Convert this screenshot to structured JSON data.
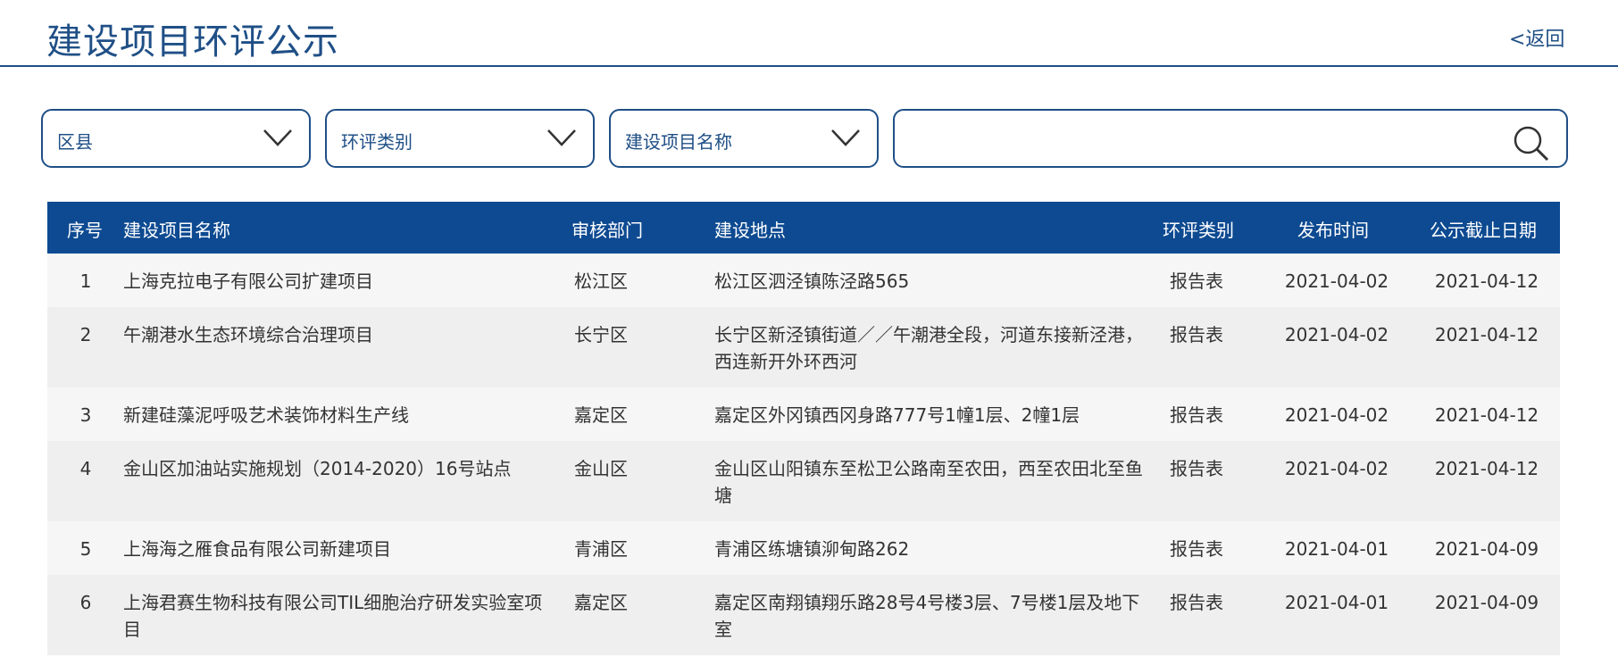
{
  "header": {
    "title": "建设项目环评公示",
    "back_label": "<返回"
  },
  "filters": {
    "district_label": "区县",
    "type_label": "环评类别",
    "name_label": "建设项目名称",
    "search_value": "",
    "search_placeholder": ""
  },
  "table": {
    "columns": [
      "序号",
      "建设项目名称",
      "审核部门",
      "建设地点",
      "环评类别",
      "发布时间",
      "公示截止日期"
    ],
    "rows": [
      {
        "idx": "1",
        "name": "上海克拉电子有限公司扩建项目",
        "dept": "松江区",
        "addr": "松江区泗泾镇陈泾路565",
        "type": "报告表",
        "pub": "2021-04-02",
        "end": "2021-04-12"
      },
      {
        "idx": "2",
        "name": "午潮港水生态环境综合治理项目",
        "dept": "长宁区",
        "addr": "长宁区新泾镇街道／／午潮港全段，河道东接新泾港，西连新开外环西河",
        "type": "报告表",
        "pub": "2021-04-02",
        "end": "2021-04-12"
      },
      {
        "idx": "3",
        "name": "新建硅藻泥呼吸艺术装饰材料生产线",
        "dept": "嘉定区",
        "addr": "嘉定区外冈镇西冈身路777号1幢1层、2幢1层",
        "type": "报告表",
        "pub": "2021-04-02",
        "end": "2021-04-12"
      },
      {
        "idx": "4",
        "name": "金山区加油站实施规划（2014-2020）16号站点",
        "dept": "金山区",
        "addr": "金山区山阳镇东至松卫公路南至农田，西至农田北至鱼塘",
        "type": "报告表",
        "pub": "2021-04-02",
        "end": "2021-04-12"
      },
      {
        "idx": "5",
        "name": "上海海之雁食品有限公司新建项目",
        "dept": "青浦区",
        "addr": "青浦区练塘镇泖甸路262",
        "type": "报告表",
        "pub": "2021-04-01",
        "end": "2021-04-09"
      },
      {
        "idx": "6",
        "name": "上海君赛生物科技有限公司TIL细胞治疗研发实验室项目",
        "dept": "嘉定区",
        "addr": "嘉定区南翔镇翔乐路28号4号楼3层、7号楼1层及地下室",
        "type": "报告表",
        "pub": "2021-04-01",
        "end": "2021-04-09"
      }
    ]
  }
}
